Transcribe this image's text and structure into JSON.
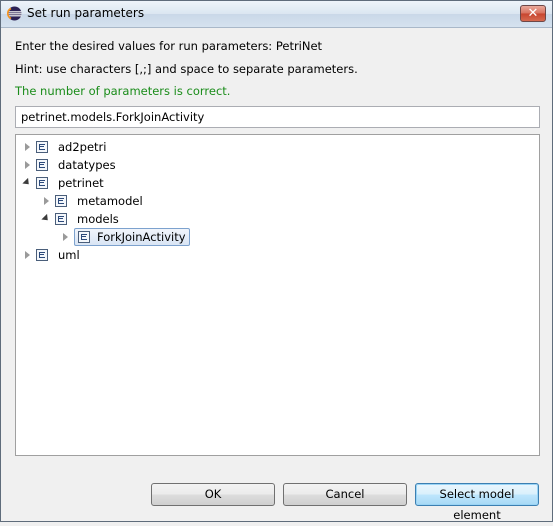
{
  "window": {
    "title": "Set run parameters",
    "close_glyph": "✕"
  },
  "instructions": {
    "line1": "Enter the desired values for run parameters: PetriNet",
    "line2": "Hint: use characters [,;] and space to separate parameters.",
    "status": "The number of parameters is correct.",
    "status_color": "#1a8c1a"
  },
  "input": {
    "value": "petrinet.models.ForkJoinActivity"
  },
  "tree": {
    "items": [
      {
        "label": "ad2petri",
        "icon": "package-icon",
        "expanded": false
      },
      {
        "label": "datatypes",
        "icon": "package-icon",
        "expanded": false
      },
      {
        "label": "petrinet",
        "icon": "package-icon",
        "expanded": true
      },
      {
        "label": "metamodel",
        "icon": "package-icon",
        "expanded": false
      },
      {
        "label": "models",
        "icon": "package-icon",
        "expanded": true
      },
      {
        "label": "ForkJoinActivity",
        "icon": "package-icon",
        "expanded": false,
        "selected": true
      },
      {
        "label": "uml",
        "icon": "package-icon",
        "expanded": false
      }
    ]
  },
  "buttons": {
    "ok": "OK",
    "cancel": "Cancel",
    "select": "Select model element"
  }
}
